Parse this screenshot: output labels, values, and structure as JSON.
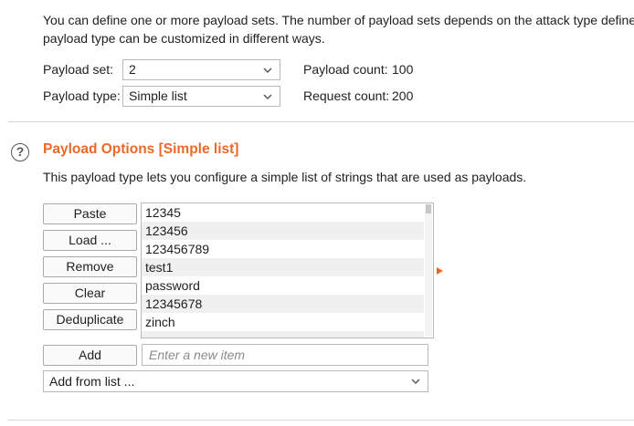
{
  "payload_sets": {
    "description_line1": "You can define one or more payload sets. The number of payload sets depends on the attack type defined",
    "description_line2": "payload type can be customized in different ways.",
    "set_label": "Payload set:",
    "set_value": "2",
    "type_label": "Payload type:",
    "type_value": "Simple list",
    "count_label": "Payload count:",
    "count_value": "100",
    "request_label": "Request count:",
    "request_value": "200"
  },
  "payload_options": {
    "help_glyph": "?",
    "title": "Payload Options [Simple list]",
    "description": "This payload type lets you configure a simple list of strings that are used as payloads.",
    "buttons": {
      "paste": "Paste",
      "load": "Load ...",
      "remove": "Remove",
      "clear": "Clear",
      "deduplicate": "Deduplicate",
      "add": "Add"
    },
    "list_items": [
      "12345",
      "123456",
      "123456789",
      "test1",
      "password",
      "12345678",
      "zinch"
    ],
    "new_item_placeholder": "Enter a new item",
    "add_from_list": "Add from list ..."
  },
  "icons": {
    "help": "help-circle-icon",
    "dropdown": "chevron-down-icon",
    "selection_marker": "caret-right-icon"
  },
  "colors": {
    "accent": "#e8692a"
  }
}
